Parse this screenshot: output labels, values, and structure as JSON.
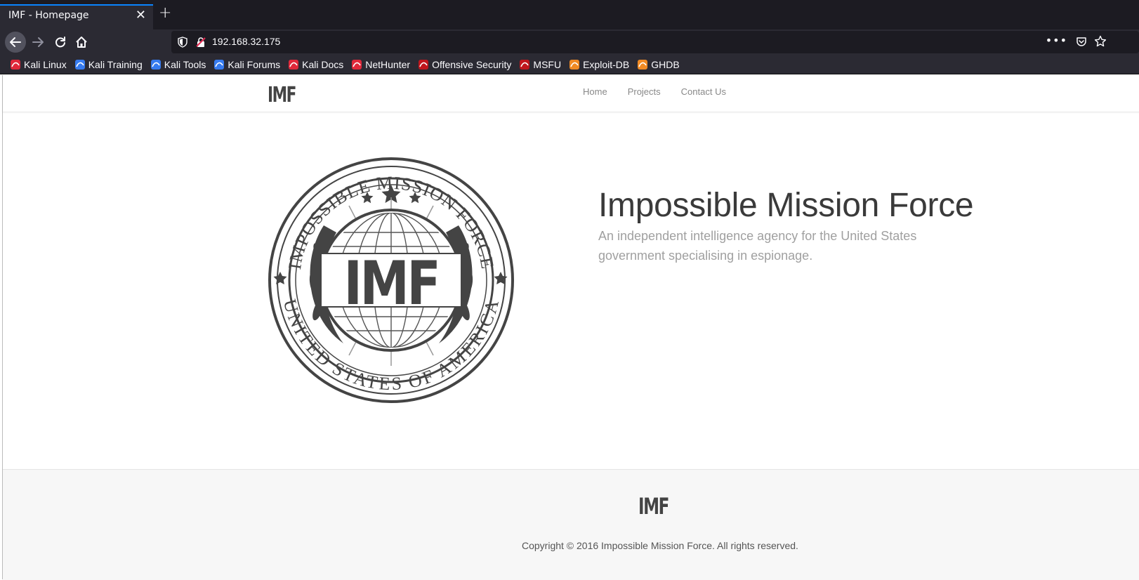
{
  "browser": {
    "tab_title": "IMF - Homepage",
    "tab_close": "✕",
    "new_tab": "+",
    "url": "192.168.32.175",
    "more_menu": "•••",
    "bookmarks": [
      {
        "label": "Kali Linux",
        "icon": "kali-dragon-icon",
        "color": "#e0283a"
      },
      {
        "label": "Kali Training",
        "icon": "kali-training-icon",
        "color": "#367bf0"
      },
      {
        "label": "Kali Tools",
        "icon": "kali-tools-icon",
        "color": "#367bf0"
      },
      {
        "label": "Kali Forums",
        "icon": "kali-forums-icon",
        "color": "#367bf0"
      },
      {
        "label": "Kali Docs",
        "icon": "kali-docs-icon",
        "color": "#e0283a"
      },
      {
        "label": "NetHunter",
        "icon": "nethunter-icon",
        "color": "#e0283a"
      },
      {
        "label": "Offensive Security",
        "icon": "offsec-icon",
        "color": "#c0161c"
      },
      {
        "label": "MSFU",
        "icon": "msfu-icon",
        "color": "#c0161c"
      },
      {
        "label": "Exploit-DB",
        "icon": "exploitdb-icon",
        "color": "#f08a24"
      },
      {
        "label": "GHDB",
        "icon": "ghdb-icon",
        "color": "#f08a24"
      }
    ]
  },
  "site": {
    "brand": "IMF",
    "nav": [
      "Home",
      "Projects",
      "Contact Us"
    ],
    "seal": {
      "top_text": "IMPOSSIBLE MISSION FORCE",
      "bottom_text": "UNITED STATES OF AMERICA",
      "center_text": "IMF"
    },
    "hero_title": "Impossible Mission Force",
    "hero_subtitle": "An independent intelligence agency for the United States government specialising in espionage.",
    "footer_brand": "IMF",
    "copyright": "Copyright © 2016 Impossible Mission Force. All rights reserved."
  },
  "colors": {
    "chrome_dark": "#1c1b22",
    "chrome": "#2b2a33",
    "accent": "#0a84ff",
    "seal": "#444444"
  }
}
